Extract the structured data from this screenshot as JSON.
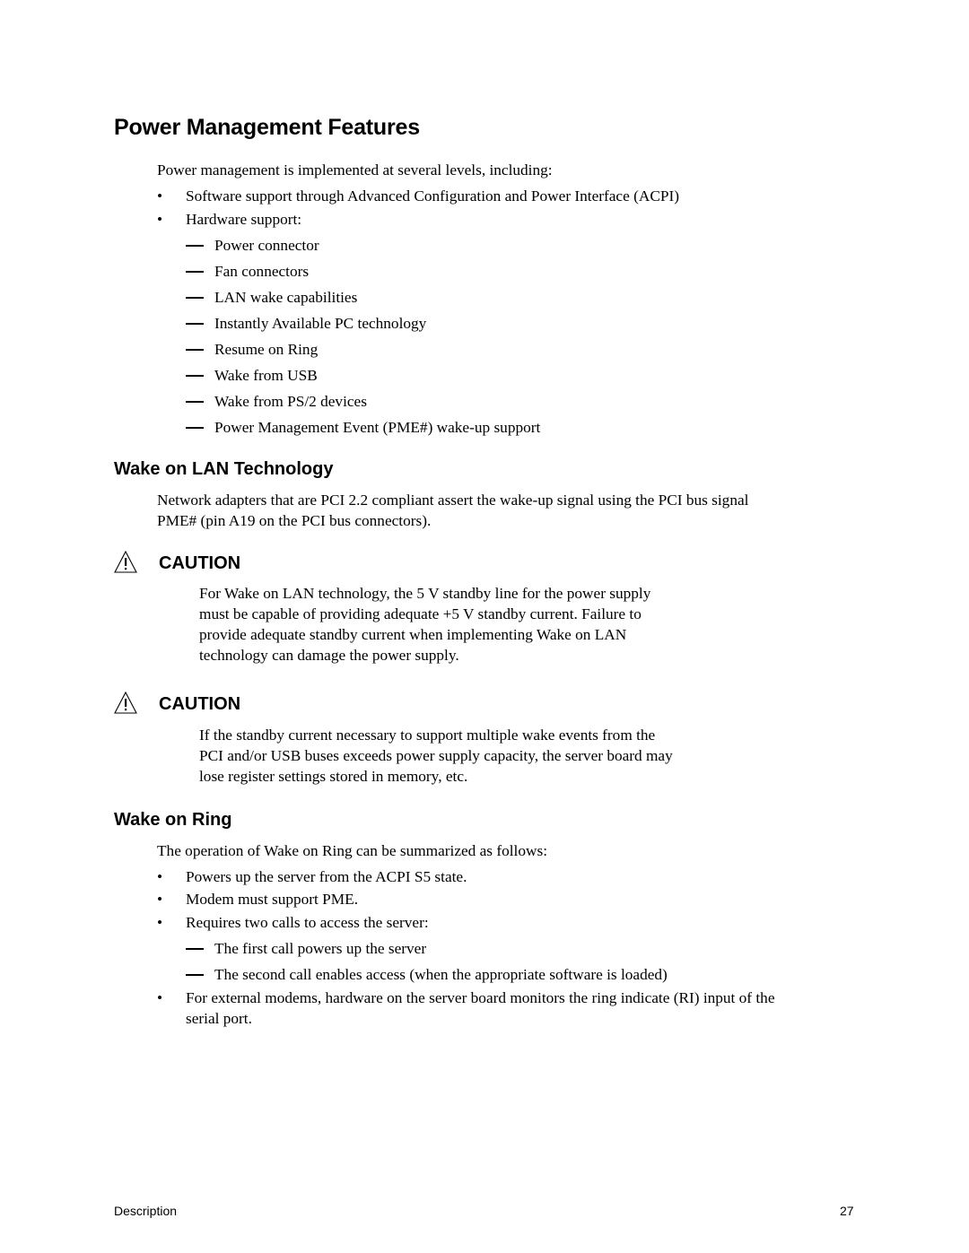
{
  "section_title": "Power Management Features",
  "intro": "Power management is implemented at several levels, including:",
  "levels": [
    "Software support through Advanced Configuration and Power Interface (ACPI)",
    "Hardware support:"
  ],
  "hardware_items": [
    "Power connector",
    "Fan connectors",
    "LAN wake capabilities",
    "Instantly Available PC technology",
    "Resume on Ring",
    "Wake from USB",
    "Wake from PS/2 devices",
    "Power Management Event (PME#) wake-up support"
  ],
  "wol": {
    "title": "Wake on LAN Technology",
    "body": [
      "Network adapters that are PCI 2.2 compliant assert the wake-up signal using the PCI bus signal",
      "PME# (pin A19 on the PCI bus connectors)."
    ]
  },
  "cautions": [
    {
      "label": "CAUTION",
      "icon": "warning-triangle-icon",
      "lines": [
        "For Wake on LAN technology, the 5 V standby line for the power supply",
        "must be capable of providing adequate +5 V standby current.  Failure to",
        "provide adequate standby current when implementing Wake on LAN",
        "technology can damage the power supply."
      ]
    },
    {
      "label": "CAUTION",
      "icon": "warning-triangle-icon",
      "lines": [
        "If the standby current necessary to support multiple wake events from the",
        "PCI and/or USB buses exceeds power supply capacity, the server board may",
        "lose register settings stored in memory, etc."
      ]
    }
  ],
  "wor": {
    "title": "Wake on Ring",
    "intro": "The operation of Wake on Ring can be summarized as follows:",
    "bullets": [
      "Powers up the server from the ACPI S5 state.",
      "Modem must support PME.",
      "Requires two calls to access the server:"
    ],
    "sub_items": [
      "The first call powers up the server",
      "The second call enables access (when the appropriate software is loaded)"
    ],
    "last_bullet": [
      "For external modems, hardware on the server board monitors the ring indicate (RI) input of the",
      "serial port."
    ]
  },
  "footer": {
    "section": "Description",
    "page_number": "27"
  }
}
